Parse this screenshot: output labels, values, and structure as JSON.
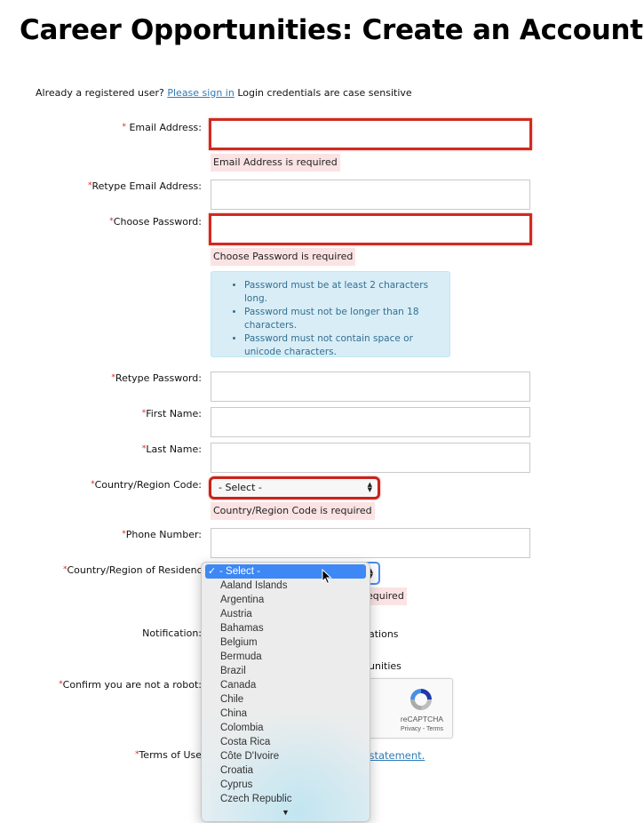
{
  "page": {
    "title": "Career Opportunities: Create an Account",
    "intro_text": "Already a registered user?",
    "sign_in_link": "Please sign in",
    "intro_note": "Login credentials are case sensitive"
  },
  "form": {
    "required_mark": "*",
    "email": {
      "label": "Email Address:",
      "value": "",
      "error": "Email Address is required"
    },
    "retype_email": {
      "label": "Retype Email Address:",
      "value": ""
    },
    "password": {
      "label": "Choose Password:",
      "value": "",
      "error": "Choose Password is required"
    },
    "password_rules": [
      "Password must be at least 2 characters long.",
      "Password must not be longer than 18 characters.",
      "Password must not contain space or unicode characters."
    ],
    "retype_password": {
      "label": "Retype Password:",
      "value": ""
    },
    "first_name": {
      "label": "First Name:",
      "value": ""
    },
    "last_name": {
      "label": "Last Name:",
      "value": ""
    },
    "country_code": {
      "label": "Country/Region Code:",
      "selected": "- Select -",
      "error": "Country/Region Code is required"
    },
    "phone": {
      "label": "Phone Number:",
      "value": ""
    },
    "residence": {
      "label": "Country/Region of Residence",
      "selected": "- Select -",
      "error_partial": "equired",
      "options": [
        "- Select -",
        "Aaland Islands",
        "Argentina",
        "Austria",
        "Bahamas",
        "Belgium",
        "Bermuda",
        "Brazil",
        "Canada",
        "Chile",
        "China",
        "Colombia",
        "Costa Rica",
        "Côte D'Ivoire",
        "Croatia",
        "Cyprus",
        "Czech Republic"
      ]
    },
    "notification": {
      "label": "Notification:",
      "option1_partial": "ations",
      "option2_partial": "unities"
    },
    "robot": {
      "label": "Confirm you are not a robot:",
      "captcha_brand": "reCAPTCHA",
      "captcha_links": "Privacy - Terms"
    },
    "terms": {
      "label": "Terms of Use",
      "link_partial": "y statement."
    }
  }
}
